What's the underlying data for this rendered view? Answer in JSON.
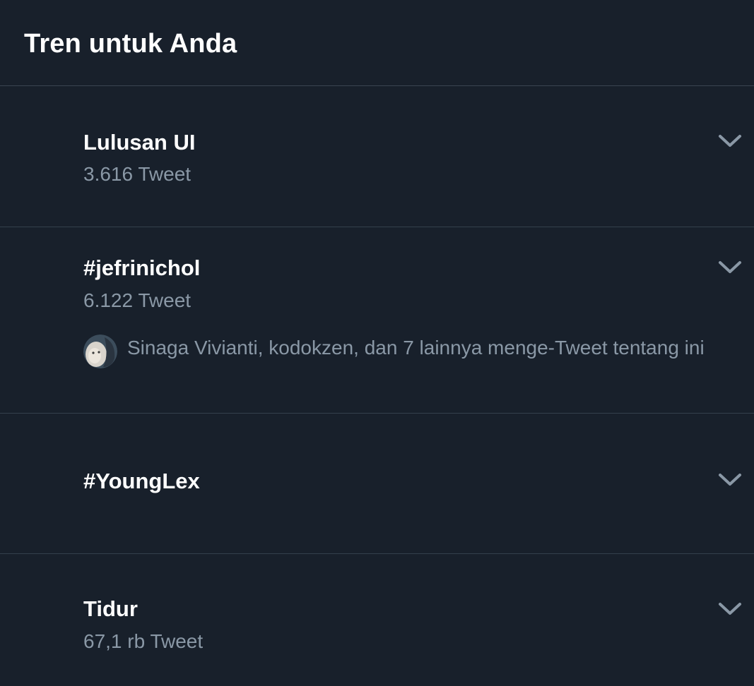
{
  "header": {
    "title": "Tren untuk Anda"
  },
  "trends": [
    {
      "name": "Lulusan UI",
      "count": "3.616 Tweet"
    },
    {
      "name": "#jefrinichol",
      "count": "6.122 Tweet",
      "context": "Sinaga Vivianti, kodokzen, dan 7 lainnya menge-Tweet tentang ini",
      "context_avatar": "user-avatar"
    },
    {
      "name": "#YoungLex"
    },
    {
      "name": "Tidur",
      "count": "67,1 rb Tweet"
    }
  ],
  "icons": {
    "more_options": "chevron-down-icon"
  },
  "colors": {
    "background": "#18202b",
    "primary_text": "#ffffff",
    "secondary_text": "#8a98a6",
    "divider": "#34404c",
    "chevron": "#8a98a6"
  }
}
